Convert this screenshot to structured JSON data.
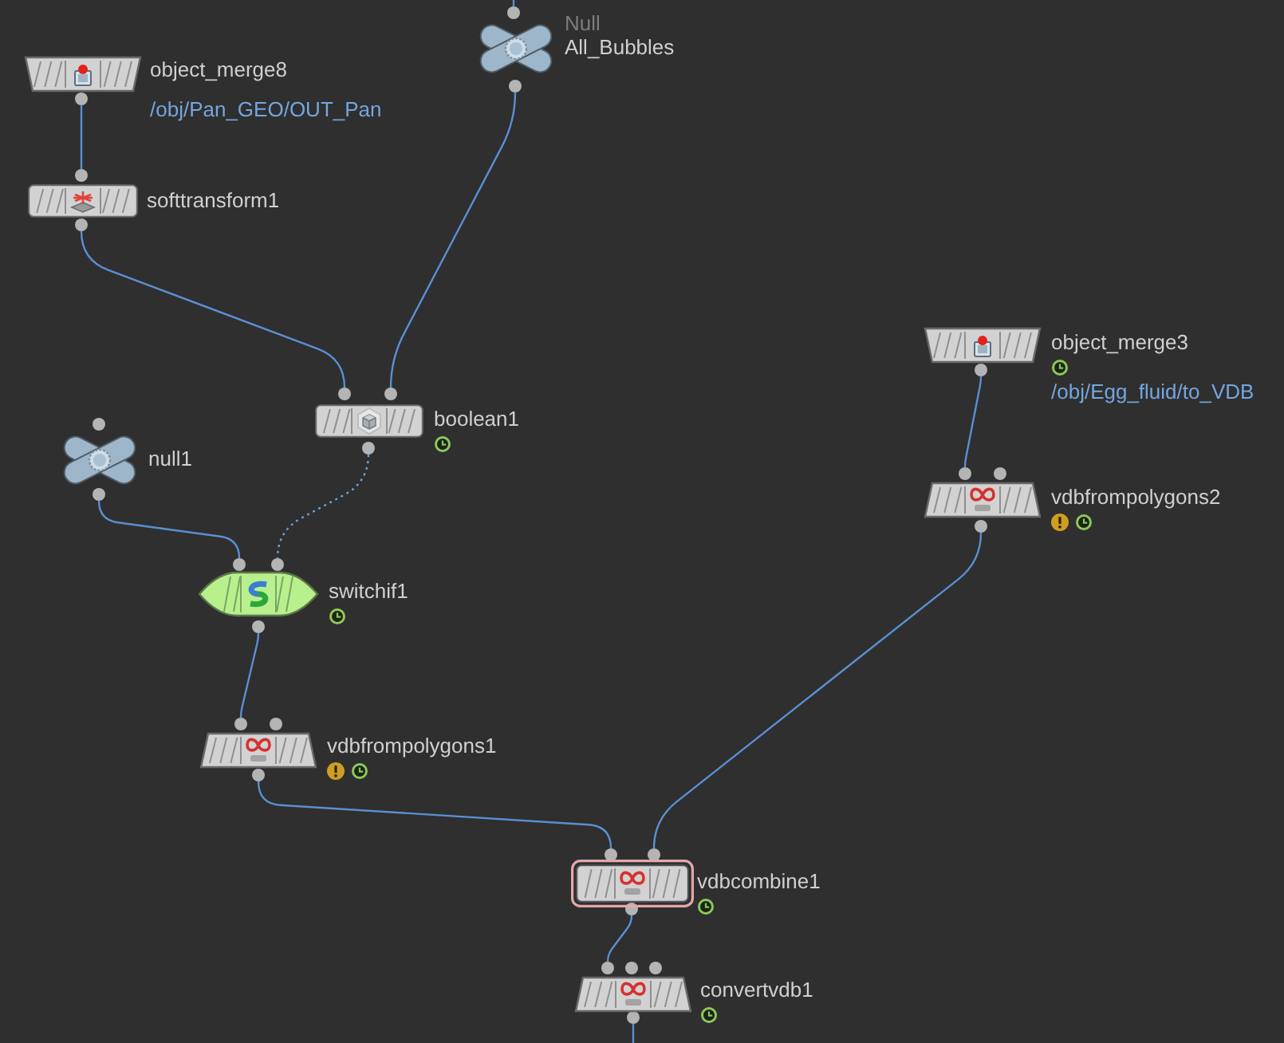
{
  "nodes": [
    {
      "kind": "null",
      "type_label": "Null",
      "name": "All_Bubbles",
      "color": "#9db6ca",
      "selected": false,
      "warning": false,
      "time_dependent": false
    },
    {
      "kind": "merge",
      "name": "object_merge8",
      "path": "/obj/Pan_GEO/OUT_Pan",
      "color": "#d2d2d2",
      "selected": false,
      "warning": false,
      "time_dependent": false
    },
    {
      "kind": "softtransform",
      "name": "softtransform1",
      "color": "#d2d2d2",
      "selected": false,
      "warning": false,
      "time_dependent": false
    },
    {
      "kind": "merge",
      "name": "object_merge3",
      "path": "/obj/Egg_fluid/to_VDB",
      "color": "#d2d2d2",
      "selected": false,
      "warning": false,
      "time_dependent": true
    },
    {
      "kind": "boolean",
      "name": "boolean1",
      "color": "#d2d2d2",
      "selected": false,
      "warning": false,
      "time_dependent": true
    },
    {
      "kind": "null",
      "name": "null1",
      "color": "#9db6ca",
      "selected": false,
      "warning": false,
      "time_dependent": false
    },
    {
      "kind": "vdbfrompolygons",
      "name": "vdbfrompolygons2",
      "color": "#d2d2d2",
      "selected": false,
      "warning": true,
      "time_dependent": true
    },
    {
      "kind": "switchif",
      "name": "switchif1",
      "color": "#b8f08e",
      "selected": false,
      "warning": false,
      "time_dependent": true
    },
    {
      "kind": "vdbfrompolygons",
      "name": "vdbfrompolygons1",
      "color": "#d2d2d2",
      "selected": false,
      "warning": true,
      "time_dependent": true
    },
    {
      "kind": "vdbcombine",
      "name": "vdbcombine1",
      "color": "#d2d2d2",
      "selected": true,
      "warning": false,
      "time_dependent": true
    },
    {
      "kind": "convertvdb",
      "name": "convertvdb1",
      "color": "#d2d2d2",
      "selected": false,
      "warning": false,
      "time_dependent": true
    }
  ],
  "wires": [
    {
      "active": true
    },
    {
      "active": true
    },
    {
      "active": true
    },
    {
      "active": true
    },
    {
      "active": true
    },
    {
      "active": false
    },
    {
      "active": true
    },
    {
      "active": true
    },
    {
      "active": true
    },
    {
      "active": true
    },
    {
      "active": true
    },
    {
      "active": true
    }
  ]
}
